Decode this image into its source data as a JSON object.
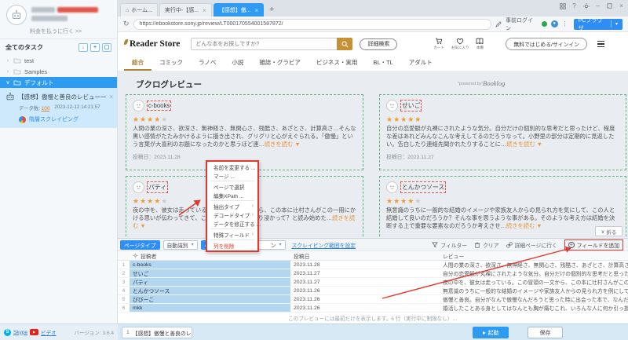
{
  "colors": {
    "accent_blue": "#2f9bf4",
    "selection_blue": "#b3d7f0",
    "store_gold": "#a8873a",
    "annotation_red": "#e0392e",
    "star_orange": "#f09d2e",
    "card_dash_green": "#57b87b",
    "link_blue": "#2b7fd4"
  },
  "glyphs": {
    "home": "⌂",
    "close": "×",
    "new_tab": "+",
    "refresh": "↻",
    "more_vert": "⋮",
    "dropdown": "▾",
    "submenu": "›",
    "tree_open": "∨",
    "tree_closed": "›",
    "collapse_chevron": "∨",
    "minimize": "–",
    "help": "?",
    "import": "↓",
    "add": "+",
    "box": "▢"
  },
  "sidebar": {
    "pay_link": "料金を払うに行く >>",
    "all_tasks_label": "全てのタスク",
    "tree": [
      {
        "label": "test"
      },
      {
        "label": "Samples"
      },
      {
        "label": "デフォルト"
      }
    ],
    "task": {
      "title": "【感想】傲慢と善良のレビュー一覧(ソニ...",
      "data_count_label": "データ数:",
      "data_count": "100",
      "timestamp": "2023-12-12 14:21:57",
      "type_label": "階層スクレイピング"
    },
    "footer": {
      "skype_label": "Skype",
      "video_label": "ビデオ",
      "version_label": "バージョン: 3.6.4"
    }
  },
  "browser": {
    "tabs": [
      {
        "label": "ホーム..."
      },
      {
        "label": "実行中-【感..."
      },
      {
        "label": "【感想】傲..."
      }
    ],
    "url": "https://ebookstore.sony.jp/review/LT000170554001587872/",
    "prelogin_label": "事前ログイン",
    "browser_mode_button": "PCブラウザ"
  },
  "store": {
    "logo": "Reader Store",
    "search_placeholder": "どんな本をお探しですか?",
    "advanced_search": "詳細検索",
    "header_icons": [
      {
        "label": "カート"
      },
      {
        "label": "お気に入り"
      },
      {
        "label": "本棚"
      }
    ],
    "signin_button": "無料ではじめる/サインイン",
    "nav": [
      "総合",
      "コミック",
      "ラノベ",
      "小説",
      "雑誌・グラビア",
      "ビジネス・実用",
      "BL・TL",
      "アダルト"
    ],
    "section_title": "ブクログレビュー",
    "powered_by": "\"powered by\"",
    "powered_brand": "Booklog"
  },
  "reviews": [
    {
      "name": "c-books",
      "stars": 4,
      "text": "人間の業の深さ、欲深さ、無神経さ、無関心さ、残酷さ、あざとさ、計算高さ…そんな黒い感情がたたみかけるように描き出され、グリグリと心がえぐられる。「傲慢」という言葉が大喜利のお題になったのかと思うほど連…",
      "more": "続きを読む ▼",
      "date_label": "投稿日：2023.11.28"
    },
    {
      "name": "せいご",
      "stars": 5,
      "text": "自分の恋愛観が丸裸にされたような気分。自分だけの個別的な思考だと思ったけど、程度な差はあれどみんなこんな考えしてるのだろうなって。小野里の部分は定期的に見返したい。告白したり連絡先聞かれたりすることに…",
      "more": "続きを読む ▼",
      "date_label": "投稿日：2023.11.27"
    },
    {
      "name": "パティ",
      "stars": 4,
      "text": "夜の中を、彼女は走っている。この冒頭の一文から、この本に辻村さんがこの一冊にかける思いが伝わってきて、こちらも物語にどっぷり浸かって？と読み始めた…",
      "more": "続きを読む ▼",
      "date_label": ""
    },
    {
      "name": "とんかつソース",
      "stars": 4,
      "text": "無意識のうちに一般的な結婚のイメージや家族友人からの見られ方を気にして、この人と結婚して良いのだろうか？そんな事を思うような事がある。そのような考え方は結婚を決断する上で重要な要素なのだろうか考えさせ…",
      "more": "続きを読む ▼",
      "date_label": ""
    }
  ],
  "context_menu": {
    "items": [
      {
        "label": "名前を変更する ..."
      },
      {
        "label": "マージ ..."
      },
      {
        "label": "ページで選択"
      },
      {
        "label": "編集XPath ..."
      },
      {
        "label": "抽出タイプ",
        "submenu": true
      },
      {
        "label": "デコードタイプ",
        "submenu": true
      },
      {
        "label": "データを修正する ..."
      },
      {
        "label": "特殊フィールド",
        "submenu": true
      },
      {
        "label": "列を削除",
        "danger": true
      }
    ]
  },
  "panel": {
    "collapse_button": "折る",
    "toolbar": {
      "page_type_button": "ページタイプ",
      "page_type_value": "自動識別",
      "page_button2": "ページ",
      "page_value2": "ン",
      "range_link": "スクレイピング範囲を設定",
      "filter": "フィルター",
      "clear": "クリア",
      "goto_detail": "詳細ページに行く",
      "add_field": "フィールドを追加"
    },
    "table": {
      "columns": [
        "投稿者",
        "投稿日",
        "レビュー"
      ],
      "rows": [
        {
          "num": "1",
          "name": "c-books",
          "date": "2023.11.28",
          "review": "人間の業の深さ、欲深さ、無神経さ、無関心さ、残酷さ、あざとさ、計算高さ…そんな黒い"
        },
        {
          "num": "2",
          "name": "せいご",
          "date": "2023.11.27",
          "review": "自分の恋愛観が丸裸にされたような気分。自分だけの個別的な思考だと思ったけど、程度な"
        },
        {
          "num": "3",
          "name": "パティ",
          "date": "2023.11.27",
          "review": "夜の中を、彼女は走っている。この冒頭の一文から、この本に辻村さんがこの一冊にかける"
        },
        {
          "num": "4",
          "name": "とんかつソース",
          "date": "2023.11.26",
          "review": "無意識のうちに一般的な結婚のイメージや家族友人からの見られ方を例にして、この人と結"
        },
        {
          "num": "5",
          "name": "びびーこ",
          "date": "2023.11.26",
          "review": "傲慢と善良。自分がなんで傲慢なんだろうと思った時に出会った本で、なんだ小説か、、、"
        },
        {
          "num": "6",
          "name": "mkk",
          "date": "2023.11.26",
          "review": "婚活したことある身としてはなんとも胸が痛むこれ、いろんな人に何か引っ掛かるところが"
        }
      ],
      "note": "このプレビューには最初だけを表示します。6 行（実行中に制限なし）…"
    }
  },
  "footer": {
    "task_tab_index": "1",
    "task_tab": "【感想】傲慢と善良のレビュー...",
    "run_button": "起動",
    "save_button": "保存"
  }
}
